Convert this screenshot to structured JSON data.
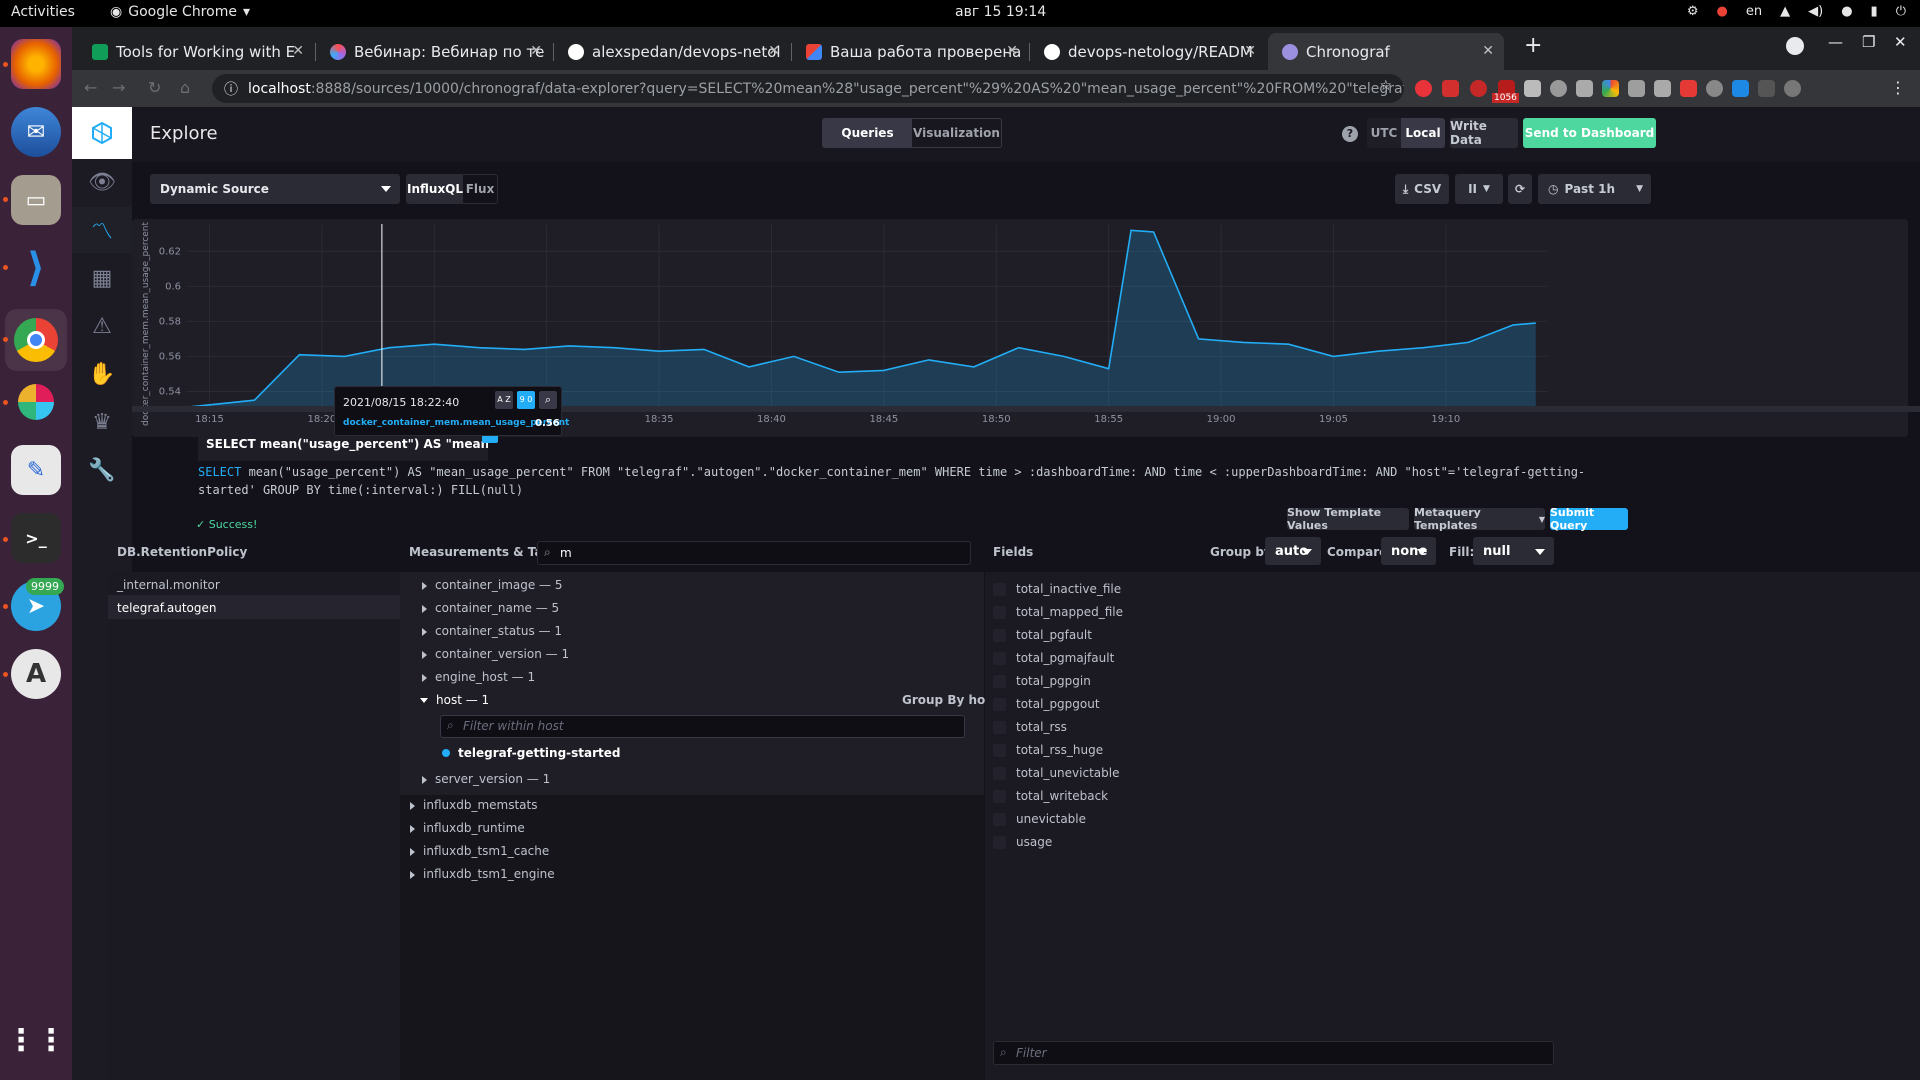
{
  "os": {
    "activities": "Activities",
    "app_menu": "Google Chrome",
    "clock": "авг 15  19:14",
    "lang": "en"
  },
  "dock": {
    "telegram_badge": "9999"
  },
  "browser": {
    "tabs": [
      {
        "title": "Tools for Working with E",
        "favicon": "#0f9d58"
      },
      {
        "title": "Вебинар: Вебинар по те",
        "favicon": "#a066e8"
      },
      {
        "title": "alexspedan/devops-netol",
        "favicon": "#ffffff"
      },
      {
        "title": "Ваша работа проверена",
        "favicon": "#d93025"
      },
      {
        "title": "devops-netology/READM",
        "favicon": "#ffffff"
      },
      {
        "title": "Chronograf",
        "favicon": "#9b8fe0"
      }
    ],
    "url_host": "localhost",
    "url_rest": ":8888/sources/10000/chronograf/data-explorer?query=SELECT%20mean%28\"usage_percent\"%29%20AS%20\"mean_usage_percent\"%20FROM%20\"telegraf\".\"auto...",
    "ext_badge": "1056"
  },
  "header": {
    "title": "Explore",
    "tab_queries": "Queries",
    "tab_visualization": "Visualization",
    "utc": "UTC",
    "local": "Local",
    "write_data": "Write Data",
    "send_dashboard": "Send to Dashboard",
    "help": "?"
  },
  "toolbar": {
    "source": "Dynamic Source",
    "influxql": "InfluxQL",
    "flux": "Flux",
    "csv": "CSV",
    "pause": "II",
    "timerange": "Past 1h"
  },
  "chart_data": {
    "type": "area",
    "ylabel": "docker_container_mem.mean_usage_percent",
    "yticks": [
      "0.62",
      "0.6",
      "0.58",
      "0.56",
      "0.54"
    ],
    "ylim": [
      0.53,
      0.635
    ],
    "xticks": [
      "18:15",
      "18:20",
      "18:25",
      "18:30",
      "18:35",
      "18:40",
      "18:45",
      "18:50",
      "18:55",
      "19:00",
      "19:05",
      "19:10"
    ],
    "x_minutes_from_1814": [
      0,
      3,
      5,
      7,
      9,
      11,
      13,
      15,
      17,
      19,
      21,
      23,
      25,
      27,
      29,
      31,
      33,
      35,
      37,
      39,
      41,
      42,
      43,
      45,
      47,
      49,
      51,
      53,
      55,
      57,
      59,
      60
    ],
    "values": [
      0.531,
      0.535,
      0.561,
      0.56,
      0.565,
      0.567,
      0.565,
      0.564,
      0.566,
      0.565,
      0.563,
      0.564,
      0.554,
      0.56,
      0.551,
      0.552,
      0.558,
      0.554,
      0.565,
      0.56,
      0.553,
      0.632,
      0.631,
      0.57,
      0.568,
      0.567,
      0.56,
      0.563,
      0.565,
      0.568,
      0.578,
      0.579
    ],
    "series": [
      {
        "name": "docker_container_mem.mean_usage_percent"
      }
    ],
    "color": "#22adf6"
  },
  "tooltip": {
    "time": "2021/08/15 18:22:40",
    "series": "docker_container_mem.mean_usage_percent",
    "value": "0.56",
    "sort_az": "A Z",
    "sort_09": "9 0"
  },
  "query": {
    "tab": "SELECT mean(\"usage_percent\") AS \"mean_usage...",
    "text_kw1": "SELECT",
    "text_a": " mean(\"usage_percent\") AS \"mean_usage_percent\" FROM \"telegraf\".\"autogen\".\"docker_container_mem\" WHERE time > :dashboardTime: AND time < :upperDashboardTime: AND \"host\"='telegraf-getting-started' GROUP BY time(:interval:) FILL(null)",
    "status": "Success!",
    "show_template": "Show Template Values",
    "metaquery": "Metaquery Templates",
    "submit": "Submit Query"
  },
  "db": {
    "header": "DB.RetentionPolicy",
    "items": [
      "_internal.monitor",
      "telegraf.autogen"
    ]
  },
  "measurements": {
    "header": "Measurements & Tags",
    "search": "m",
    "tags": [
      "container_image — 5",
      "container_name — 5",
      "container_status — 1",
      "container_version — 1",
      "engine_host — 1"
    ],
    "host": "host — 1",
    "group_by": "Group By host",
    "filter_placeholder": "Filter within host",
    "host_value": "telegraf-getting-started",
    "server_version": "server_version — 1",
    "others": [
      "influxdb_memstats",
      "influxdb_runtime",
      "influxdb_tsm1_cache",
      "influxdb_tsm1_engine"
    ]
  },
  "fields": {
    "header": "Fields",
    "group_by_label": "Group by:",
    "group_by": "auto",
    "compare_label": "Compare:",
    "compare": "none",
    "fill_label": "Fill:",
    "fill": "null",
    "items": [
      "total_inactive_file",
      "total_mapped_file",
      "total_pgfault",
      "total_pgmajfault",
      "total_pgpgin",
      "total_pgpgout",
      "total_rss",
      "total_rss_huge",
      "total_unevictable",
      "total_writeback",
      "unevictable",
      "usage"
    ],
    "filter_placeholder": "Filter"
  }
}
